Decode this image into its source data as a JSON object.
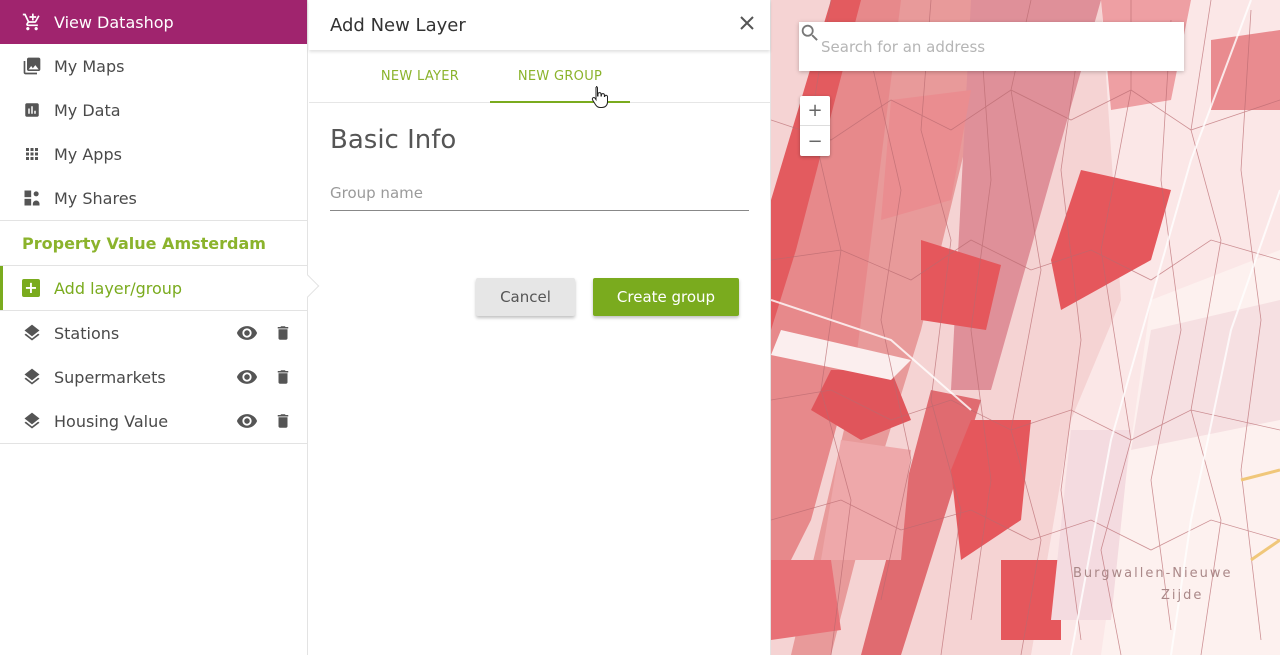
{
  "sidebar": {
    "datashop_label": "View Datashop",
    "nav": [
      {
        "label": "My Maps",
        "icon": "image-icon"
      },
      {
        "label": "My Data",
        "icon": "bar-chart-icon"
      },
      {
        "label": "My Apps",
        "icon": "grid-icon"
      },
      {
        "label": "My Shares",
        "icon": "share-icon"
      }
    ],
    "project_title": "Property Value Amsterdam",
    "add_layer_label": "Add layer/group",
    "layers": [
      {
        "label": "Stations"
      },
      {
        "label": "Supermarkets"
      },
      {
        "label": "Housing Value"
      }
    ]
  },
  "panel": {
    "title": "Add New Layer",
    "tabs": [
      {
        "label": "NEW LAYER",
        "active": false
      },
      {
        "label": "NEW GROUP",
        "active": true
      }
    ],
    "section_title": "Basic Info",
    "group_name_placeholder": "Group name",
    "group_name_value": "",
    "cancel_label": "Cancel",
    "create_label": "Create group"
  },
  "map": {
    "search_placeholder": "Search for an address",
    "zoom_in": "+",
    "zoom_out": "−",
    "district_label_1": "Burgwallen-Nieuwe",
    "district_label_2": "Zijde"
  },
  "colors": {
    "brand_purple": "#a0246e",
    "accent_green": "#7aab1e"
  }
}
